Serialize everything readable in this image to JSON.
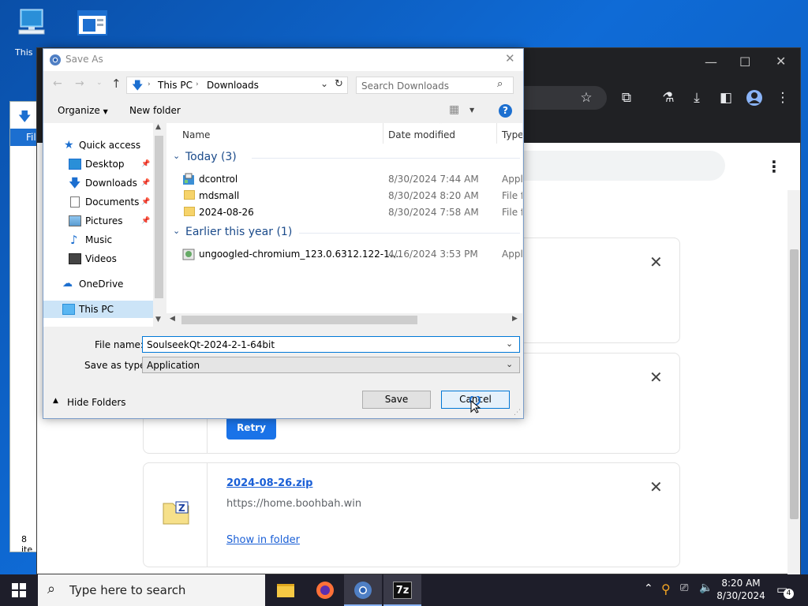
{
  "desktop": {
    "icons": [
      {
        "label": "This"
      },
      {
        "label": ""
      }
    ]
  },
  "explorer": {
    "menu_label": "Fil",
    "status_count": "8 ite"
  },
  "chrome": {
    "menu_glyph": "⋮",
    "downloads": [
      {
        "filename": "",
        "url": "",
        "action": ""
      },
      {
        "filename": "",
        "url": "",
        "action": "Retry"
      },
      {
        "filename": "2024-08-26.zip",
        "url": "https://home.boohbah.win",
        "action": "Show in folder"
      }
    ]
  },
  "dialog": {
    "title": "Save As",
    "breadcrumb": [
      "This PC",
      "Downloads"
    ],
    "search_placeholder": "Search Downloads",
    "toolbar": {
      "organize": "Organize",
      "new_folder": "New folder",
      "help": "?"
    },
    "nav": {
      "quick_access": "Quick access",
      "items": [
        {
          "label": "Desktop",
          "pinned": true
        },
        {
          "label": "Downloads",
          "pinned": true
        },
        {
          "label": "Documents",
          "pinned": true
        },
        {
          "label": "Pictures",
          "pinned": true
        },
        {
          "label": "Music",
          "pinned": false
        },
        {
          "label": "Videos",
          "pinned": false
        }
      ],
      "onedrive": "OneDrive",
      "this_pc": "This PC"
    },
    "columns": {
      "name": "Name",
      "date": "Date modified",
      "type": "Type"
    },
    "groups": [
      {
        "label": "Today (3)",
        "files": [
          {
            "name": "dcontrol",
            "date": "8/30/2024 7:44 AM",
            "type": "Appli"
          },
          {
            "name": "mdsmall",
            "date": "8/30/2024 8:20 AM",
            "type": "File fo"
          },
          {
            "name": "2024-08-26",
            "date": "8/30/2024 7:58 AM",
            "type": "File fo"
          }
        ]
      },
      {
        "label": "Earlier this year (1)",
        "files": [
          {
            "name": "ungoogled-chromium_123.0.6312.122-1....",
            "date": "4/16/2024 3:53 PM",
            "type": "Appli"
          }
        ]
      }
    ],
    "file_name_label": "File name:",
    "file_name_value": "SoulseekQt-2024-2-1-64bit",
    "save_type_label": "Save as type:",
    "save_type_value": "Application",
    "hide_folders": "Hide Folders",
    "save": "Save",
    "cancel": "Cancel"
  },
  "taskbar": {
    "search_placeholder": "Type here to search",
    "time": "8:20 AM",
    "date": "8/30/2024",
    "notification_count": "4"
  }
}
